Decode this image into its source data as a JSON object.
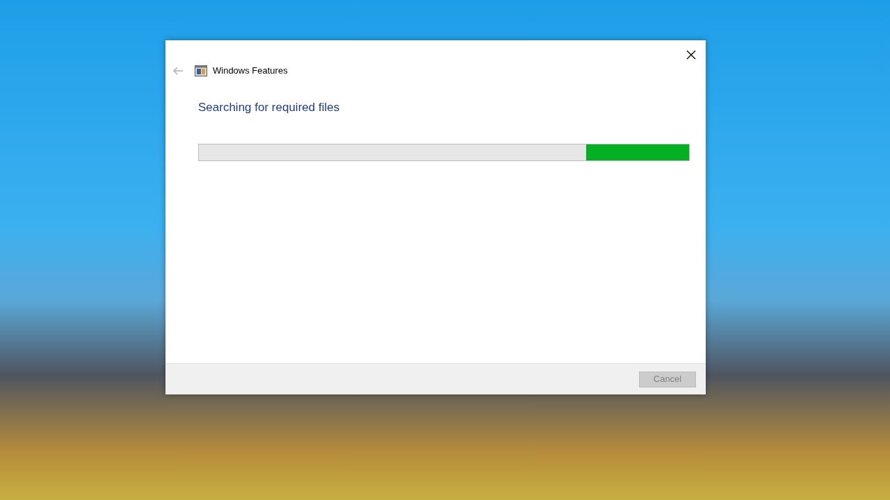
{
  "dialog": {
    "title": "Windows Features",
    "back": {
      "disabled": true
    },
    "heading": "Searching for required files",
    "progress": {
      "indeterminate": true
    },
    "cancel": {
      "label": "Cancel",
      "disabled": true
    }
  }
}
